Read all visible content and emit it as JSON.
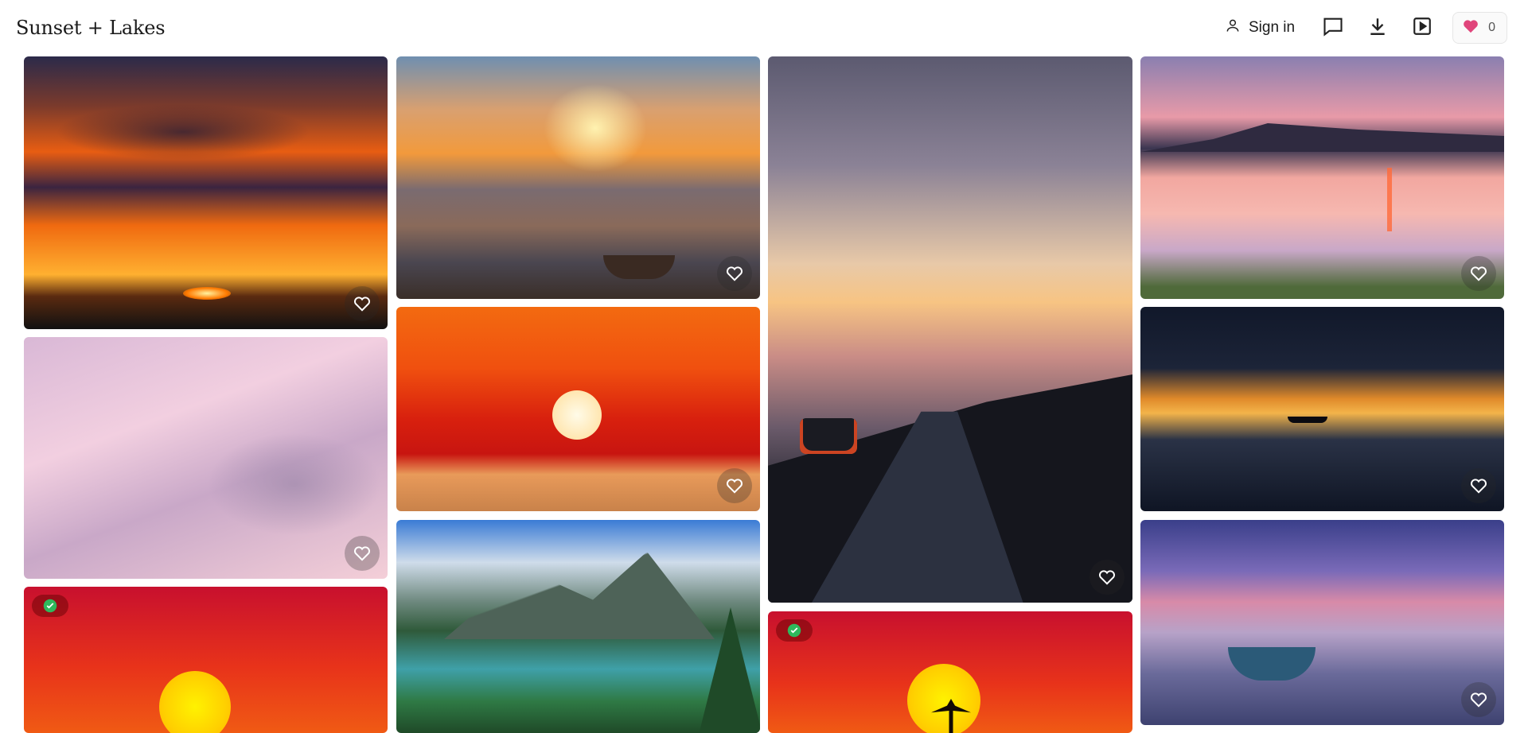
{
  "header": {
    "title": "Sunset + Lakes",
    "sign_in_label": "Sign in",
    "likes_count": "0",
    "icons": [
      "user-icon",
      "comment-icon",
      "download-icon",
      "slideshow-icon",
      "heart-icon"
    ]
  },
  "colors": {
    "like_heart": "#e0457b",
    "check_green": "#2eb85c"
  },
  "gallery": {
    "columns": 4,
    "photos": [
      {
        "name": "orange-clouds-sunset",
        "liked": false,
        "selected": false
      },
      {
        "name": "beach-boats-sunset",
        "liked": false,
        "selected": false
      },
      {
        "name": "road-car-dusk",
        "liked": false,
        "selected": false
      },
      {
        "name": "pink-lake-hills",
        "liked": false,
        "selected": false
      },
      {
        "name": "pink-clouds",
        "liked": false,
        "selected": false
      },
      {
        "name": "red-sun-sea",
        "liked": false,
        "selected": false
      },
      {
        "name": "golden-lake-boat",
        "liked": false,
        "selected": false
      },
      {
        "name": "red-sun-horizon",
        "liked": false,
        "selected": true
      },
      {
        "name": "mountain-lake-forest",
        "liked": false,
        "selected": false
      },
      {
        "name": "palm-sunset",
        "liked": false,
        "selected": true
      },
      {
        "name": "purple-lake-boat",
        "liked": false,
        "selected": false
      }
    ]
  }
}
